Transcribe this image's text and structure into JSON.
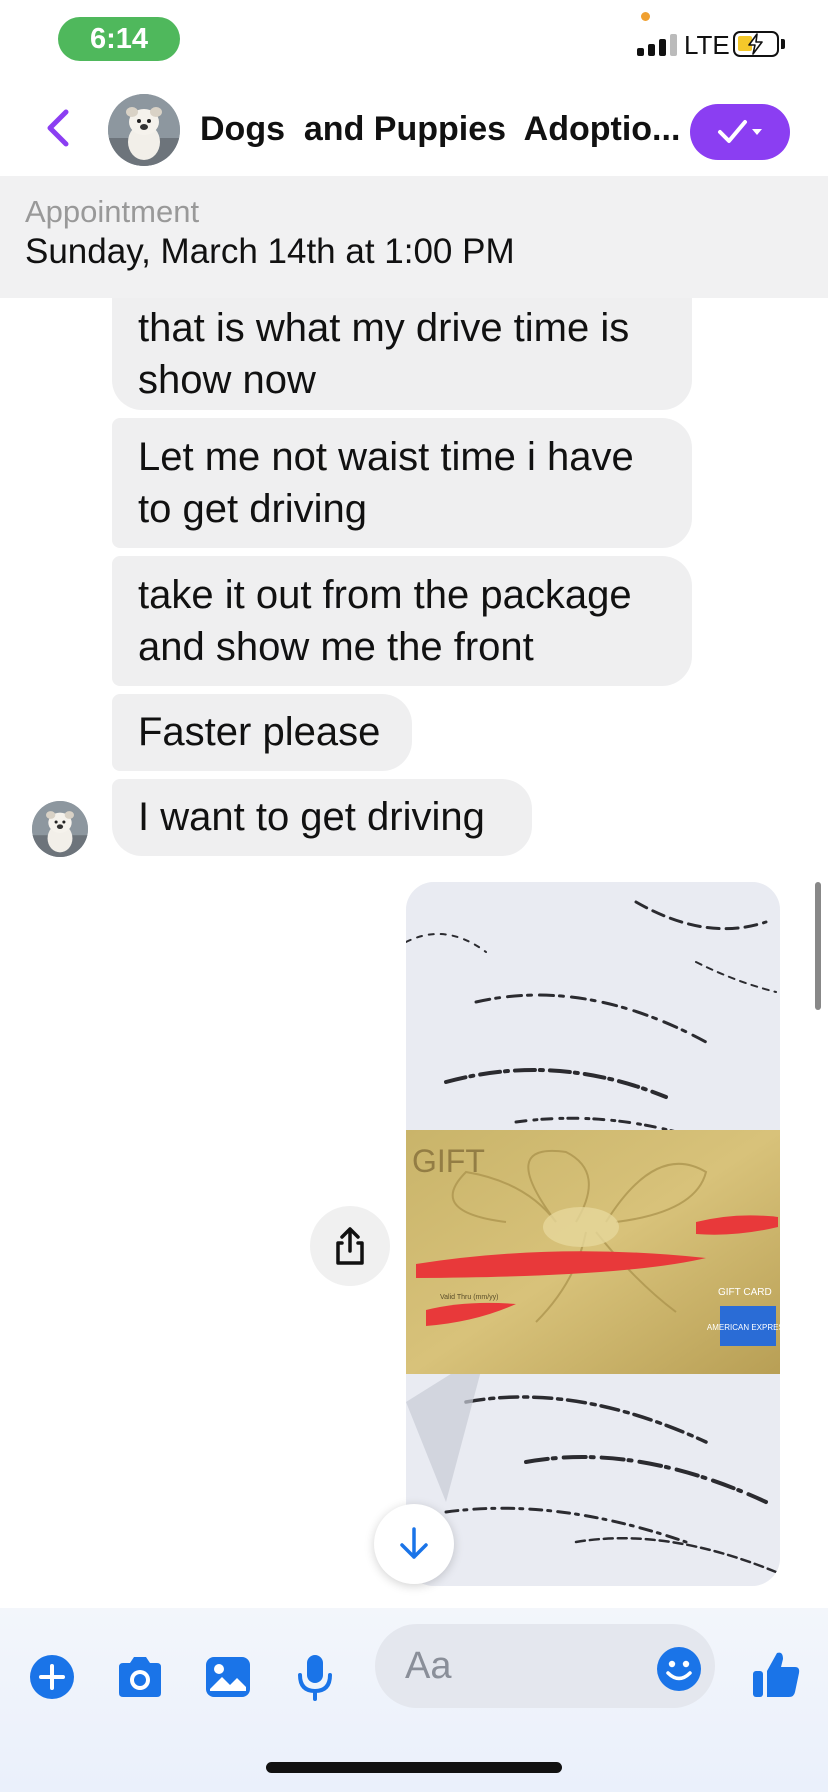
{
  "status_bar": {
    "time": "6:14",
    "network": "LTE",
    "battery_level": 0.3,
    "battery_charging": true
  },
  "header": {
    "title": "Dogs  and Puppies  Adoptio...",
    "avatar_icon": "bulldog-avatar",
    "back_icon": "chevron-left-icon",
    "action_icon": "check-dropdown-icon",
    "accent_color": "#8b3ef2"
  },
  "appointment": {
    "label": "Appointment",
    "date": "Sunday, March 14th at 1:00 PM"
  },
  "messages": [
    {
      "sender": "other",
      "text": "that is what my drive time is show now"
    },
    {
      "sender": "other",
      "text": "Let me not waist time i have to get driving"
    },
    {
      "sender": "other",
      "text": "take it out from the package and show me the front"
    },
    {
      "sender": "other",
      "text": "Faster please"
    },
    {
      "sender": "other",
      "text": "I want to get driving"
    }
  ],
  "photo": {
    "card_text": "GIFT",
    "card_label": "GIFT CARD",
    "card_brand": "AMERICAN EXPRESS",
    "card_valid_text": "Valid Thru (mm/yy)"
  },
  "composer": {
    "placeholder": "Aa",
    "icons": [
      "plus-icon",
      "camera-icon",
      "photo-icon",
      "microphone-icon",
      "emoji-icon",
      "thumbs-up-icon"
    ],
    "icon_color": "#1a74e8"
  }
}
